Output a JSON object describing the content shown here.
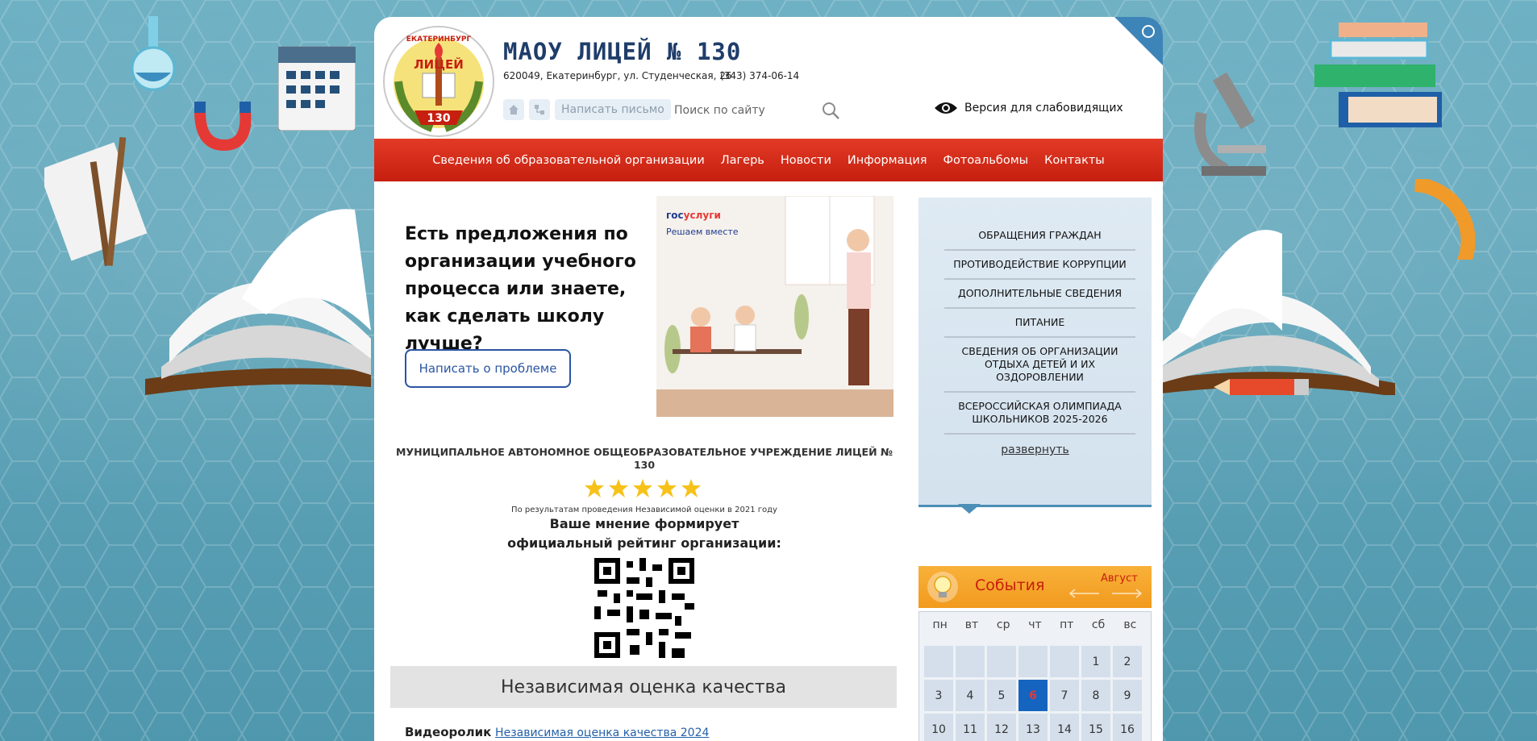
{
  "header": {
    "site_title": "МАОУ ЛИЦЕЙ № 130",
    "address": "620049, Екатеринбург, ул. Студенческая, 26",
    "phone": "(343) 374-06-14",
    "logo_text_top": "ЕКАТЕРИНБУРГ",
    "logo_text_main": "ЛИЦЕЙ",
    "logo_number": "130",
    "write_letter": "Написать письмо",
    "search_placeholder": "Поиск по сайту",
    "low_vision": "Версия для слабовидящих"
  },
  "nav": {
    "items": [
      "Сведения об образовательной организации",
      "Лагерь",
      "Новости",
      "Информация",
      "Фотоальбомы",
      "Контакты"
    ]
  },
  "promo": {
    "text": "Есть предложения по организации учебного процесса или знаете, как сделать школу лучше?",
    "button": "Написать о проблеме",
    "gos_brand_a": "гос",
    "gos_brand_b": "услуги",
    "gos_slogan": "Решаем вместе"
  },
  "rating": {
    "org": "МУНИЦИПАЛЬНОЕ АВТОНОМНОЕ ОБЩЕОБРАЗОВАТЕЛЬНОЕ УЧРЕЖДЕНИЕ ЛИЦЕЙ № 130",
    "stars": 5,
    "note": "По результатам проведения Независимой оценки в 2021 году",
    "line1": "Ваше мнение формирует",
    "line2": "официальный рейтинг организации:",
    "bar": "Независимая оценка качества"
  },
  "video": {
    "label": "Видеоролик",
    "link": "Независимая оценка качества 2024"
  },
  "sidebar": {
    "items": [
      "ОБРАЩЕНИЯ ГРАЖДАН",
      "ПРОТИВОДЕЙСТВИЕ КОРРУПЦИИ",
      "ДОПОЛНИТЕЛЬНЫЕ СВЕДЕНИЯ",
      "ПИТАНИЕ",
      "СВЕДЕНИЯ ОБ ОРГАНИЗАЦИИ ОТДЫХА ДЕТЕЙ И ИХ ОЗДОРОВЛЕНИИ",
      "ВСЕРОССИЙСКАЯ ОЛИМПИАДА ШКОЛЬНИКОВ 2025-2026"
    ],
    "expand": "развернуть"
  },
  "events": {
    "title": "События",
    "month": "Август"
  },
  "calendar": {
    "weekdays": [
      "пн",
      "вт",
      "ср",
      "чт",
      "пт",
      "сб",
      "вс"
    ],
    "days": [
      "",
      "",
      "",
      "",
      "",
      "1",
      "2",
      "3",
      "4",
      "5",
      "6",
      "7",
      "8",
      "9",
      "10",
      "11",
      "12",
      "13",
      "14",
      "15",
      "16"
    ],
    "today": "6"
  },
  "colors": {
    "nav_red": "#d22a18",
    "title_blue": "#1f3d6a",
    "events_orange": "#f5a52c",
    "today_blue": "#1565c0"
  }
}
